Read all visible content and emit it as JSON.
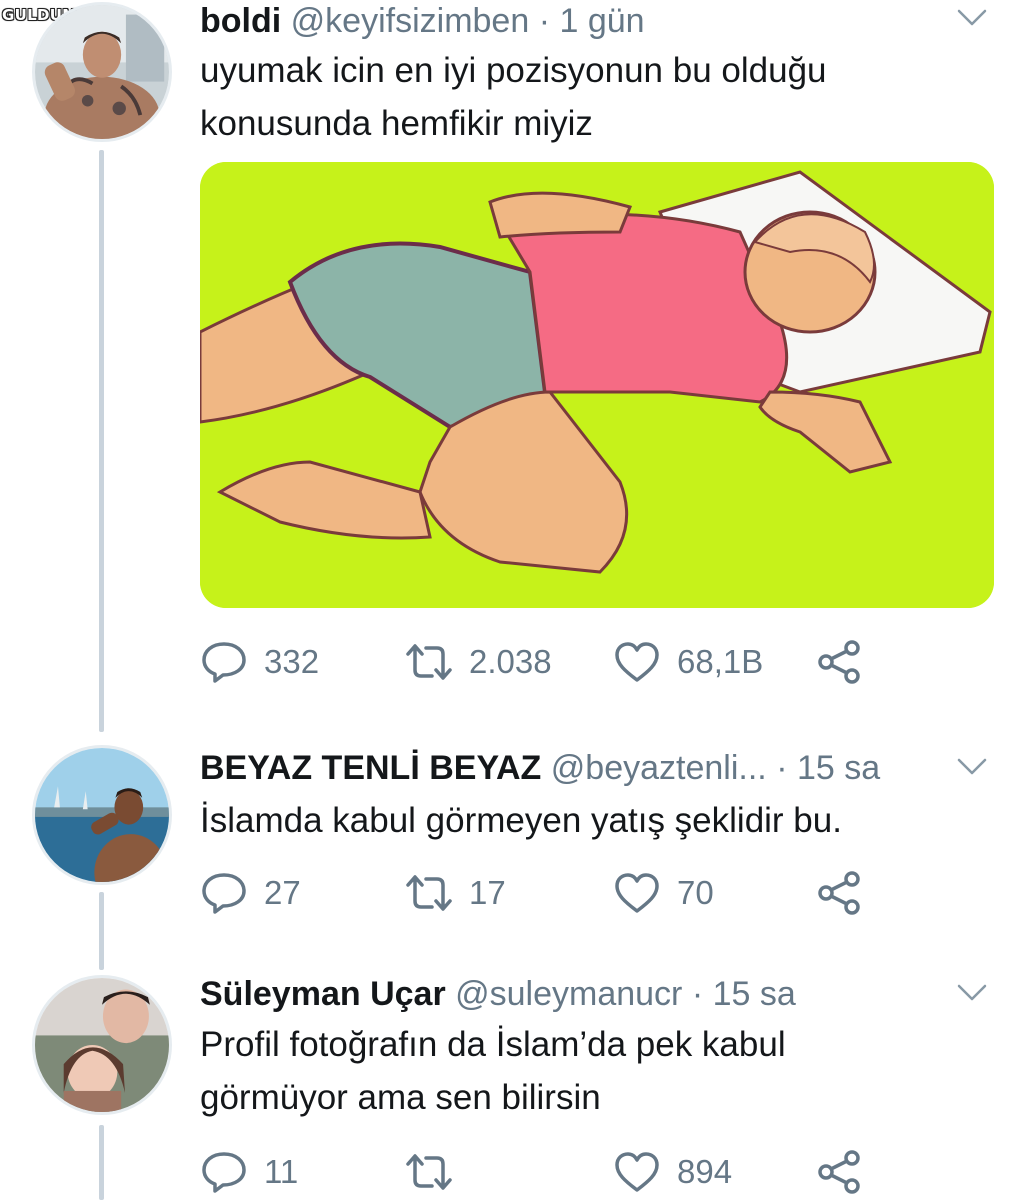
{
  "watermark": "GULDUM.NET",
  "tweets": [
    {
      "name": "boldi",
      "handle": "@keyifsizimben",
      "separator": "·",
      "time": "1 gün",
      "text_lines": [
        "uyumak icin en iyi pozisyonun bu olduğu",
        "konusunda hemfikir miyiz"
      ],
      "reply_count": "332",
      "retweet_count": "2.038",
      "like_count": "68,1B"
    },
    {
      "name": "BEYAZ TENLİ BEYAZ",
      "handle": "@beyaztenli...",
      "separator": "·",
      "time": "15 sa",
      "text_lines": [
        "İslamda kabul görmeyen yatış şeklidir bu."
      ],
      "reply_count": "27",
      "retweet_count": "17",
      "like_count": "70"
    },
    {
      "name": "Süleyman Uçar",
      "handle": "@suleymanucr",
      "separator": "·",
      "time": "15 sa",
      "text_lines": [
        "Profil fotoğrafın da İslam’da pek kabul",
        "görmüyor ama sen bilirsin"
      ],
      "reply_count": "11",
      "retweet_count": "",
      "like_count": "894"
    }
  ],
  "icons": {
    "reply": "reply-icon",
    "retweet": "retweet-icon",
    "like": "heart-icon",
    "share": "share-icon",
    "more": "chevron-down-icon"
  },
  "colors": {
    "text": "#14171a",
    "muted": "#657786",
    "thread_line": "#c9d3dc",
    "media_background": "#c6f21a"
  }
}
